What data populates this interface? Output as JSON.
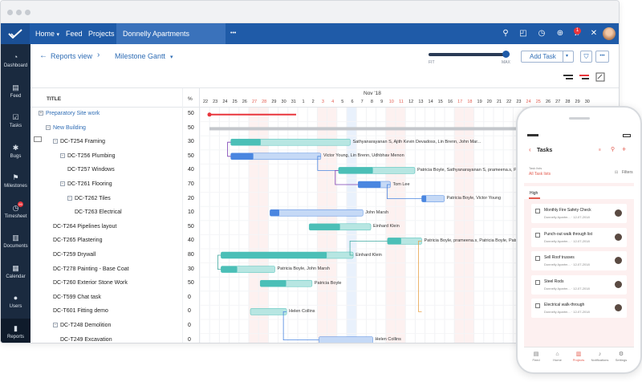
{
  "nav": {
    "home": "Home",
    "feed": "Feed",
    "projects": "Projects",
    "project_name": "Donnelly Apartments Construction",
    "more": "•••",
    "notification_count": "1"
  },
  "sidebar": [
    {
      "label": "Dashboard",
      "icon": "◔"
    },
    {
      "label": "Feed",
      "icon": "▤"
    },
    {
      "label": "Tasks",
      "icon": "☑"
    },
    {
      "label": "Bugs",
      "icon": "✱"
    },
    {
      "label": "Milestones",
      "icon": "⚑"
    },
    {
      "label": "Timesheet",
      "icon": "◷",
      "badge": "99"
    },
    {
      "label": "Documents",
      "icon": "▥"
    },
    {
      "label": "Calendar",
      "icon": "▦"
    },
    {
      "label": "Users",
      "icon": "●"
    },
    {
      "label": "Reports",
      "icon": "▮"
    }
  ],
  "toolbar": {
    "back": "←",
    "reports_view": "Reports view",
    "chevron": "›",
    "view_name": "Milestone Gantt",
    "caret": "▾",
    "fit": "FIT",
    "max": "MAX",
    "add_task": "Add Task",
    "add_task_caret": "▾",
    "filter_icon": "⛉",
    "more_icon": "•••"
  },
  "gantt": {
    "col_title": "TITLE",
    "col_pct": "%",
    "month": "Nov '18",
    "days": [
      "22",
      "23",
      "24",
      "25",
      "26",
      "27",
      "28",
      "29",
      "30",
      "31",
      "1",
      "2",
      "3",
      "4",
      "5",
      "6",
      "7",
      "8",
      "9",
      "10",
      "11",
      "12",
      "13",
      "14",
      "15",
      "16",
      "17",
      "18",
      "19",
      "20",
      "21",
      "22",
      "23",
      "24",
      "25",
      "26",
      "27",
      "28",
      "29",
      "30"
    ],
    "weekend_idx": [
      5,
      6,
      12,
      13,
      19,
      20,
      26,
      27,
      33,
      34
    ],
    "rows": [
      {
        "title": "Preparatory Site work",
        "pct": "50",
        "indent": 0,
        "blue": true,
        "exp": "+"
      },
      {
        "title": "New Building",
        "pct": "50",
        "indent": 1,
        "blue": true,
        "exp": "−"
      },
      {
        "title": "DC-T254 Framing",
        "pct": "30",
        "indent": 2,
        "blue": false,
        "exp": "−"
      },
      {
        "title": "DC-T256 Plumbing",
        "pct": "50",
        "indent": 3,
        "blue": false,
        "exp": "−"
      },
      {
        "title": "DC-T257 Windows",
        "pct": "40",
        "indent": 4,
        "blue": false,
        "exp": ""
      },
      {
        "title": "DC-T261 Flooring",
        "pct": "70",
        "indent": 3,
        "blue": false,
        "exp": "−"
      },
      {
        "title": "DC-T262 Tiles",
        "pct": "20",
        "indent": 4,
        "blue": false,
        "exp": "−"
      },
      {
        "title": "DC-T263 Electrical",
        "pct": "10",
        "indent": 5,
        "blue": false,
        "exp": ""
      },
      {
        "title": "DC-T264 Pipelines layout",
        "pct": "50",
        "indent": 2,
        "blue": false,
        "exp": ""
      },
      {
        "title": "DC-T265 Plastering",
        "pct": "40",
        "indent": 2,
        "blue": false,
        "exp": ""
      },
      {
        "title": "DC-T259 Drywall",
        "pct": "80",
        "indent": 2,
        "blue": false,
        "exp": ""
      },
      {
        "title": "DC-T278 Painting - Base Coat",
        "pct": "30",
        "indent": 2,
        "blue": false,
        "exp": ""
      },
      {
        "title": "DC-T260 Exterior Stone Work",
        "pct": "50",
        "indent": 2,
        "blue": false,
        "exp": ""
      },
      {
        "title": "DC-T599 Chat task",
        "pct": "0",
        "indent": 2,
        "blue": false,
        "exp": ""
      },
      {
        "title": "DC-T601 Fitting demo",
        "pct": "0",
        "indent": 2,
        "blue": false,
        "exp": ""
      },
      {
        "title": "DC-T248 Demolition",
        "pct": "0",
        "indent": 2,
        "blue": false,
        "exp": "−"
      },
      {
        "title": "DC-T249 Excavation",
        "pct": "0",
        "indent": 3,
        "blue": false,
        "exp": ""
      }
    ],
    "bar_labels": [
      "Sathyanarayanan S, Ajith Kevin Devadoss, Lin Brenn, John Mar...",
      "Victor Young, Lin Brenn, Udhbhav Menon",
      "Patricia Boyle, Sathyanarayanan S, prameena.s, Patricia Boyle",
      "Tom Lee",
      "Patricia Boyle, Victor Young",
      "John Marsh",
      "Einhard Klein",
      "Patricia Boyle, prameena.s, Patricia Boyle, Patricia Boyle",
      "Einhard Klein",
      "Patricia Boyle, John Marsh",
      "Patricia Boyle",
      "Helen Collins",
      "Helen Collins"
    ]
  },
  "phone": {
    "title": "Tasks",
    "task_lists_label": "Task lists",
    "all_task_lists": "All Task lists",
    "filters": "Filters",
    "section": "High",
    "cards": [
      {
        "title": "Monthly Fire Safety Check",
        "sub": "Donnelly Apartm... · 12-07-2018"
      },
      {
        "title": "Punch-out walk through list",
        "sub": "Donnelly Apartm... · 12-07-2018"
      },
      {
        "title": "Sell Roof trusses",
        "sub": "Donnelly Apartm... · 12-07-2018"
      },
      {
        "title": "Steel Rods",
        "sub": "Donnelly Apartm... · 12-07-2018"
      },
      {
        "title": "Electrical walk-through",
        "sub": "Donnelly Apartm... · 12-07-2018"
      }
    ],
    "tabs": [
      {
        "label": "Feed",
        "icon": "▤"
      },
      {
        "label": "Home",
        "icon": "⌂"
      },
      {
        "label": "Projects",
        "icon": "▥"
      },
      {
        "label": "Notifications",
        "icon": "♪"
      },
      {
        "label": "Settings",
        "icon": "⚙"
      }
    ]
  },
  "colors": {
    "brand": "#1f5ba8",
    "sidebar": "#1a2a3f",
    "bar_teal": "#4bbfb7",
    "bar_teal_light": "#b7e6e2",
    "bar_blue": "#4a86e0",
    "bar_blue_light": "#c5d9f6",
    "accent_red": "#e8353c"
  }
}
